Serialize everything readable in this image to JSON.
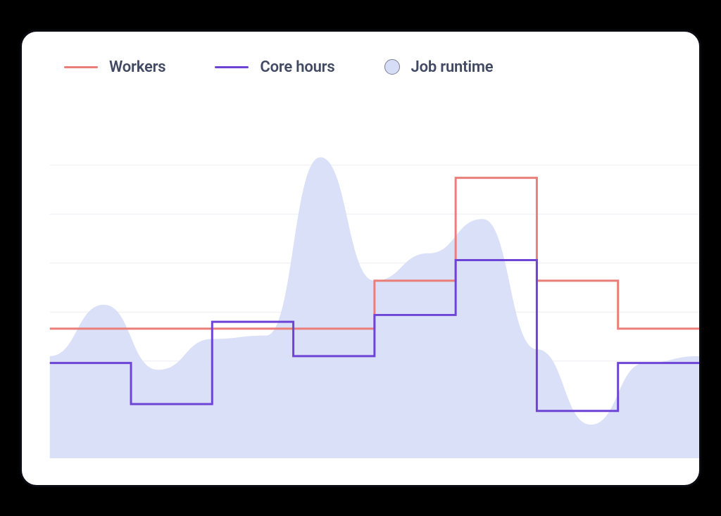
{
  "legend": {
    "workers": {
      "label": "Workers",
      "color": "#ea7e78"
    },
    "core_hours": {
      "label": "Core hours",
      "color": "#6e44d6"
    },
    "runtime": {
      "label": "Job runtime",
      "fill": "#d6ddf6"
    }
  },
  "chart_data": {
    "type": "line",
    "x": [
      0,
      1,
      2,
      3,
      4,
      5,
      6,
      7,
      8
    ],
    "xlabel": "",
    "ylabel": "",
    "ylim": [
      0,
      10
    ],
    "grid": true,
    "series": [
      {
        "name": "Workers",
        "type": "step",
        "color": "#ea7e78",
        "values": [
          3.8,
          3.8,
          3.8,
          3.8,
          5.2,
          8.2,
          5.2,
          3.8,
          3.8
        ]
      },
      {
        "name": "Core hours",
        "type": "step",
        "color": "#6e44d6",
        "values": [
          2.8,
          1.6,
          4.0,
          3.0,
          4.2,
          5.8,
          1.4,
          2.8,
          2.8
        ]
      },
      {
        "name": "Job runtime",
        "type": "area",
        "fill": "#d6ddf6",
        "values": [
          3.0,
          4.5,
          2.6,
          3.5,
          3.6,
          8.8,
          5.2,
          6.0,
          7.0,
          3.2,
          1.0,
          2.8,
          3.0
        ]
      }
    ]
  }
}
